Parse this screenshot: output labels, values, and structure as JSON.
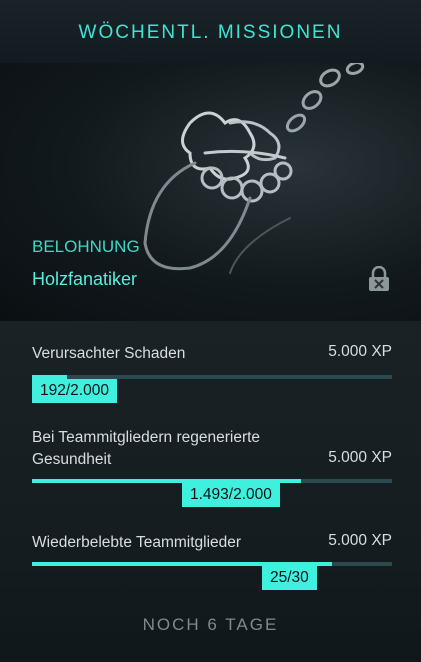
{
  "header": {
    "title": "WÖCHENTL. MISSIONEN"
  },
  "reward": {
    "section_label": "BELOHNUNG",
    "name": "Holzfanatiker",
    "lock_icon": "lock-icon"
  },
  "missions": [
    {
      "label": "Verursachter Schaden",
      "xp": "5.000 XP",
      "progress_text": "192/2.000",
      "progress": 0.096
    },
    {
      "label": "Bei Teammitgliedern regenerierte Gesundheit",
      "xp": "5.000 XP",
      "progress_text": "1.493/2.000",
      "progress": 0.7465
    },
    {
      "label": "Wiederbelebte Teammitglieder",
      "xp": "5.000 XP",
      "progress_text": "25/30",
      "progress": 0.8333
    }
  ],
  "footer": {
    "remaining": "NOCH 6 TAGE"
  },
  "colors": {
    "accent": "#3ff0df",
    "title": "#3fe4d3",
    "track": "#2a4a4d"
  }
}
